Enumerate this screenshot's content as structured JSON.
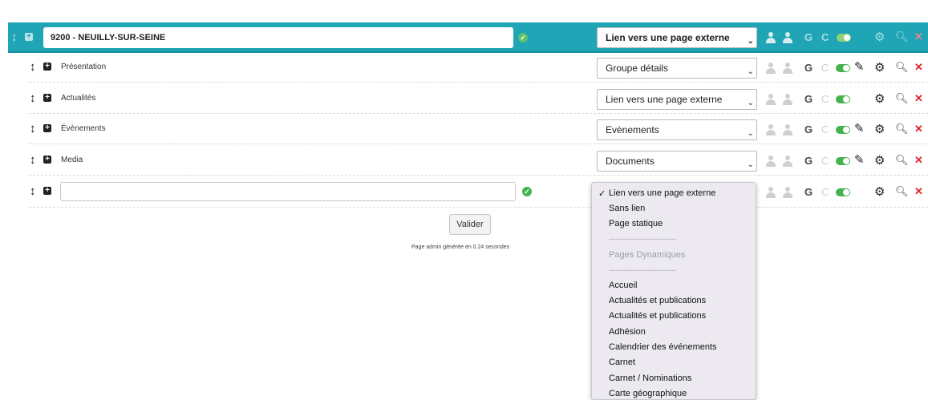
{
  "header": {
    "title_value": "9200 - NEUILLY-SUR-SEINE",
    "link_type": "Lien vers une page externe"
  },
  "rows": [
    {
      "label": "Présentation",
      "link_type": "Groupe détails",
      "has_edit": true
    },
    {
      "label": "Actualités",
      "link_type": "Lien vers une page externe",
      "has_edit": false
    },
    {
      "label": "Évènements",
      "link_type": "Evènements",
      "has_edit": true
    },
    {
      "label": "Media",
      "link_type": "Documents",
      "has_edit": true
    }
  ],
  "new_row": {
    "input_value": ""
  },
  "dropdown": {
    "selected_mark": "✓",
    "options": [
      "Lien vers une page externe",
      "Sans lien",
      "Page statique",
      "----------------------------",
      "Pages Dynamiques",
      "----------------------------",
      "Accueil",
      "Actualités et publications",
      "Actualités et publications",
      "Adhésion",
      "Calendrier des événements",
      "Carnet",
      "Carnet / Nominations",
      "Carte géographique"
    ]
  },
  "actions": {
    "google_letter": "G",
    "c_letter": "C"
  },
  "submit_label": "Valider",
  "footer": "Page admin générée en 0.24 secondes",
  "icons": [
    "move-icon",
    "expand-icon",
    "check-icon",
    "user-icon",
    "toggle-icon",
    "edit-icon",
    "gear-icon",
    "zoom-icon",
    "delete-icon"
  ],
  "colors": {
    "header_bg": "#1fa5b5",
    "toggle_green": "#44b24f",
    "delete_red": "#e0262a",
    "icon_grey": "#c8c8c8"
  }
}
